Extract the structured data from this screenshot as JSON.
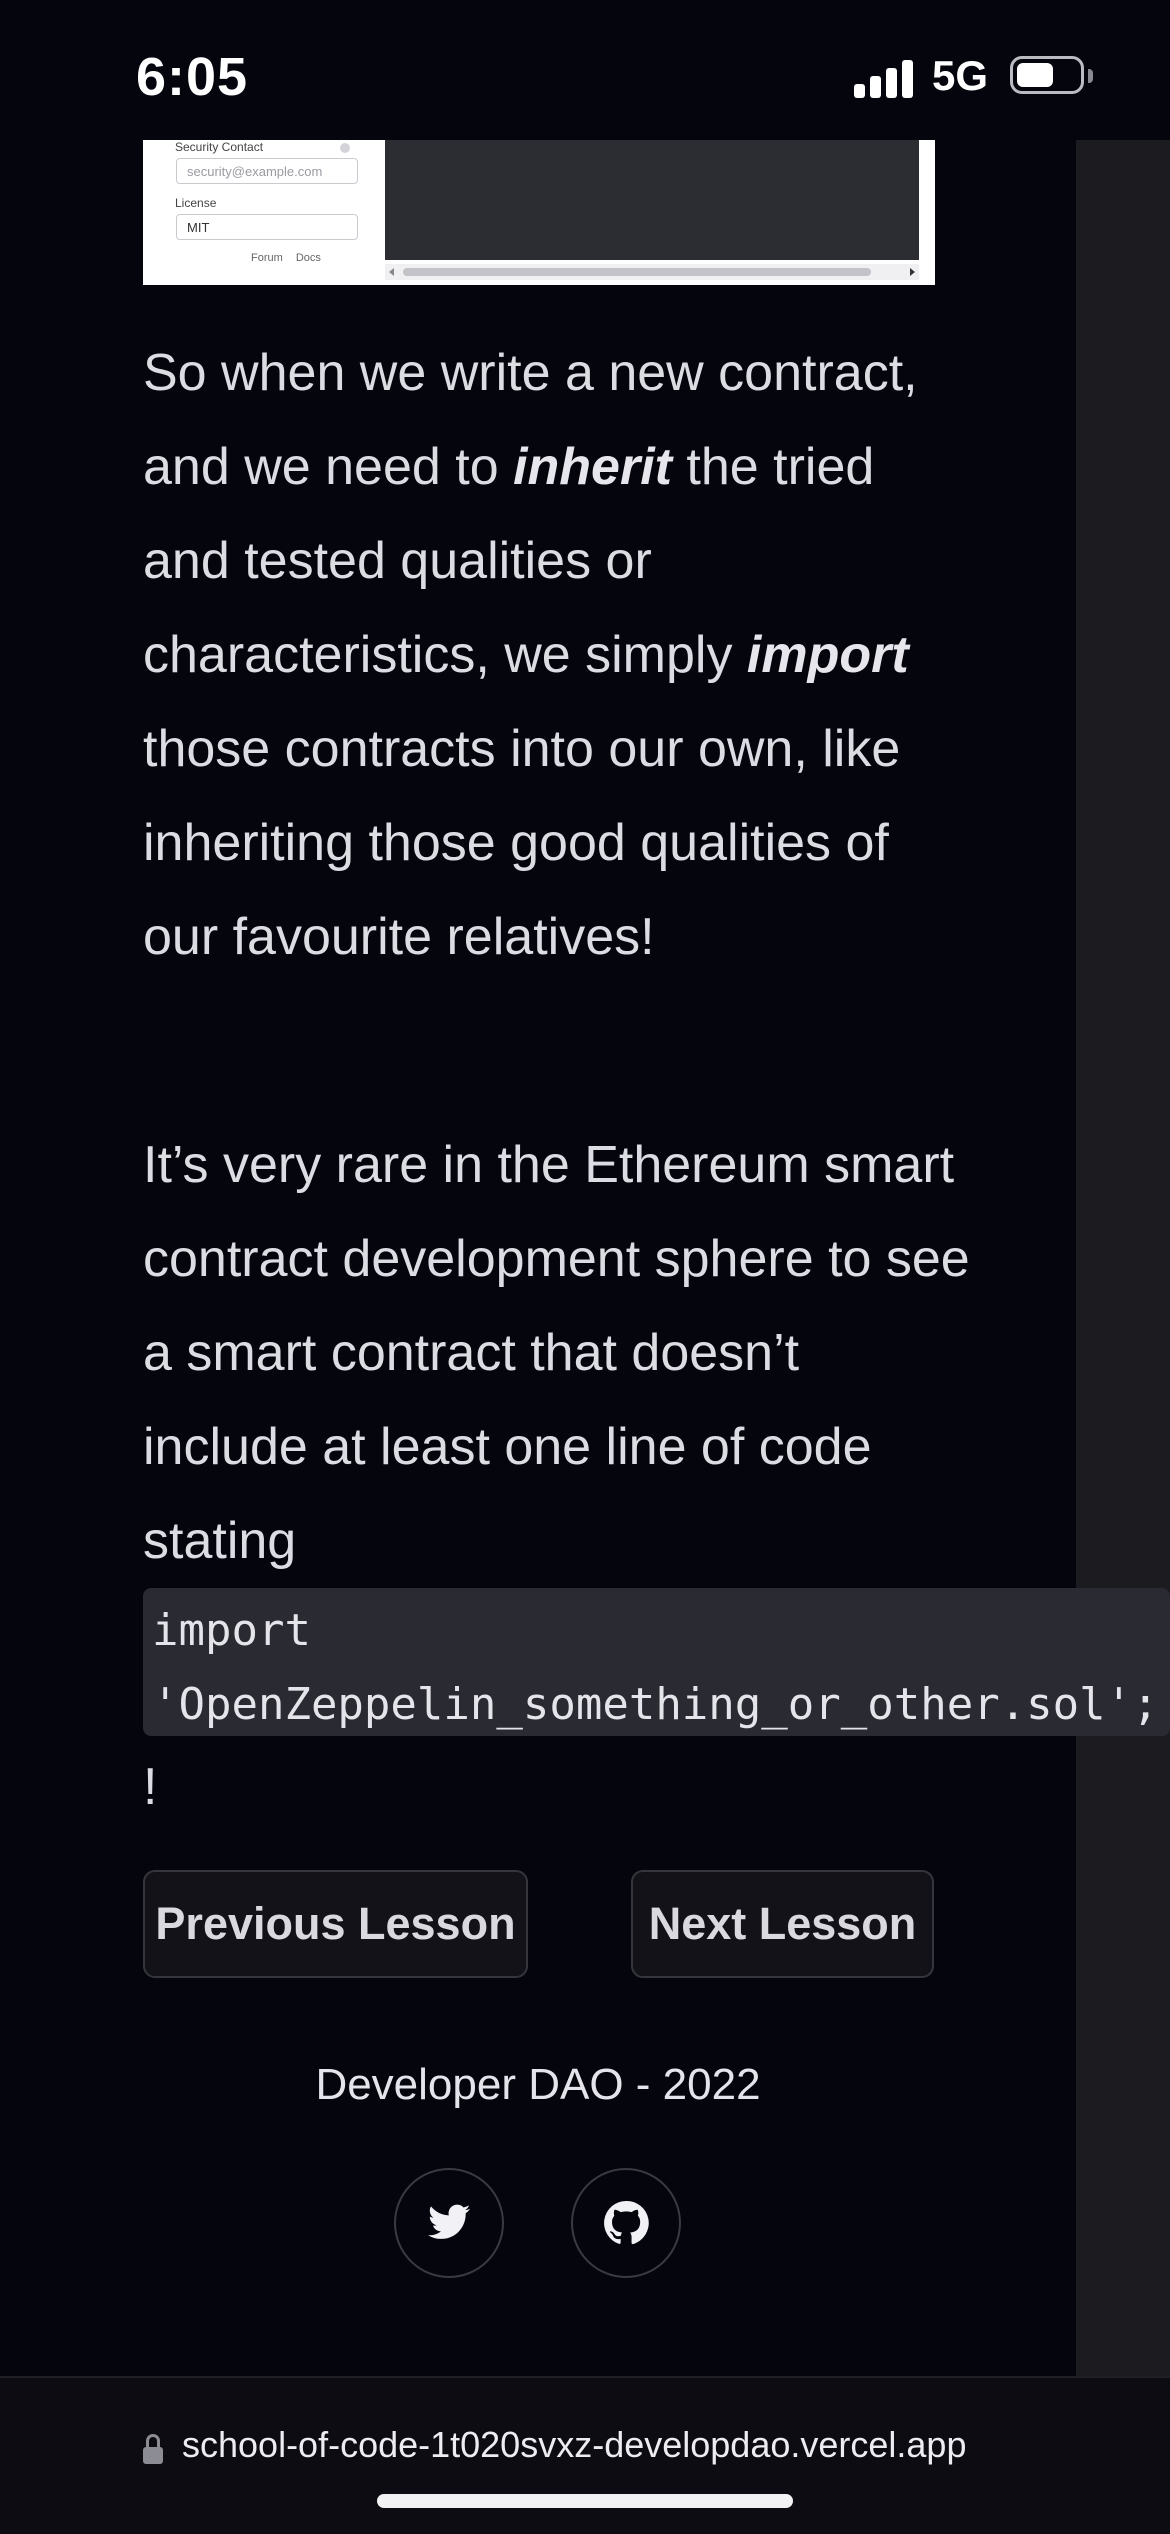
{
  "status": {
    "time": "6:05",
    "network": "5G",
    "icons": [
      "signal-icon",
      "battery-icon"
    ]
  },
  "embed": {
    "security_contact_label": "Security Contact",
    "security_contact_placeholder": "security@example.com",
    "license_label": "License",
    "license_value": "MIT",
    "forum_link": "Forum",
    "docs_link": "Docs"
  },
  "content": {
    "para1": {
      "a": "So when we write a new contract, and we need to ",
      "em1": "inherit",
      "b": " the tried and tested qualities or characteristics, we simply ",
      "em2": "import",
      "c": " those contracts into our own, like inheriting those good qualities of our favourite relatives!"
    },
    "para2": "It’s very rare in the Ethereum smart contract development sphere to see a smart contract that doesn’t include at least one line of code stating",
    "code": "import\n'OpenZeppelin_something_or_other.sol';",
    "after_code": "!"
  },
  "nav": {
    "previous": "Previous Lesson",
    "next": "Next Lesson"
  },
  "footer": {
    "text": "Developer DAO - 2022",
    "socials": [
      "twitter-icon",
      "github-icon"
    ]
  },
  "browser": {
    "url": "school-of-code-1t020svxz-developdao.vercel.app"
  }
}
